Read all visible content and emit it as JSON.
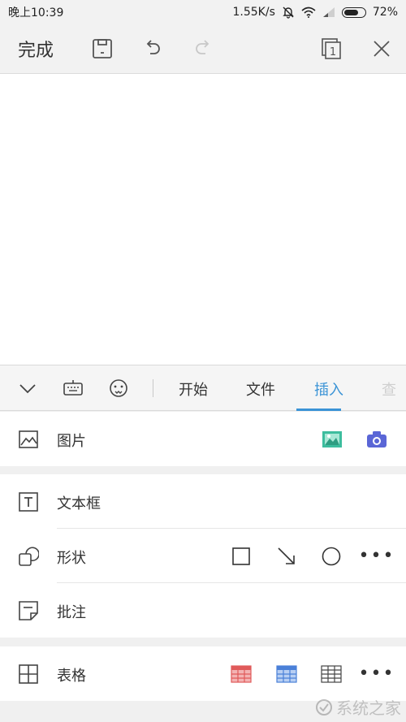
{
  "status_bar": {
    "time": "晚上10:39",
    "network_speed": "1.55K/s",
    "battery_percent": "72%",
    "battery_level": 0.72
  },
  "toolbar": {
    "done_label": "完成",
    "icons": [
      "save-icon",
      "undo-icon",
      "redo-icon",
      "page-counter-icon",
      "close-icon"
    ],
    "page_counter": "1"
  },
  "panel": {
    "tabs": [
      {
        "label": "开始",
        "active": false
      },
      {
        "label": "文件",
        "active": false
      },
      {
        "label": "插入",
        "active": true
      },
      {
        "label": "查",
        "active": false
      }
    ],
    "tab_icons": [
      "collapse-chevron-icon",
      "keyboard-icon",
      "emoji-icon"
    ],
    "accent_color": "#3a93d6",
    "rows": {
      "picture": {
        "label": "图片",
        "options": [
          "gallery-picture-icon",
          "camera-icon"
        ]
      },
      "textbox": {
        "label": "文本框"
      },
      "shape": {
        "label": "形状",
        "options": [
          "rectangle-shape-icon",
          "arrow-shape-icon",
          "circle-shape-icon",
          "more-icon"
        ],
        "more": "•••"
      },
      "comment": {
        "label": "批注"
      },
      "table": {
        "label": "表格",
        "options": [
          "red-table-icon",
          "blue-table-icon",
          "plain-table-icon",
          "more-icon"
        ],
        "more": "•••"
      }
    }
  },
  "watermark": {
    "text": "系统之家"
  }
}
